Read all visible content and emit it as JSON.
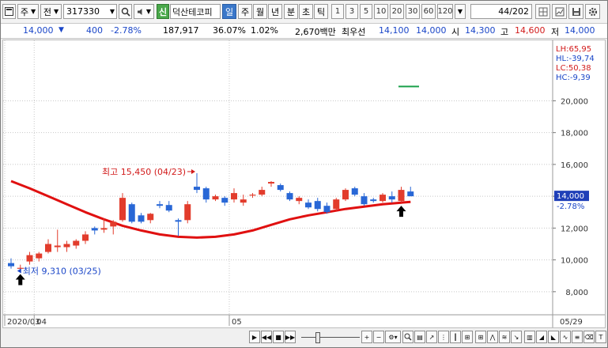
{
  "toolbar": {
    "market_label": "주",
    "period_label": "전",
    "stock_code": "317330",
    "sin_badge": "신",
    "stock_name": "덕산테코피",
    "tabs": [
      {
        "label": "일",
        "selected": true
      },
      {
        "label": "주",
        "selected": false
      },
      {
        "label": "월",
        "selected": false
      },
      {
        "label": "년",
        "selected": false
      },
      {
        "label": "분",
        "selected": false
      },
      {
        "label": "초",
        "selected": false
      },
      {
        "label": "틱",
        "selected": false
      }
    ],
    "intervals": [
      "1",
      "3",
      "5",
      "10",
      "20",
      "30",
      "60",
      "120"
    ],
    "count_value": "44",
    "count_total": "/202"
  },
  "quote": {
    "price": "14,000",
    "change": "400",
    "change_pct": "-2.78%",
    "volume": "187,917",
    "turnover_pct": "36.07%",
    "volume_pct": "1.02%",
    "amount": "2,670백만",
    "best_label": "최우선",
    "best_ask": "14,100",
    "best_bid": "14,000",
    "open_label": "시",
    "open": "14,300",
    "high_label": "고",
    "high": "14,600",
    "low_label": "저",
    "low": "14,000"
  },
  "chart_data": {
    "type": "candlestick",
    "y_ticks": [
      "20,000",
      "18,000",
      "16,000",
      "14,000",
      "12,000",
      "10,000",
      "8,000"
    ],
    "ylim": [
      6550,
      23800
    ],
    "x_labels": [
      {
        "label": "2020/03",
        "index": 0
      },
      {
        "label": "04",
        "index": 3
      },
      {
        "label": "05",
        "index": 24
      }
    ],
    "x_end_label": "05/29",
    "candles": [
      {
        "o": 9800,
        "h": 10100,
        "l": 9450,
        "c": 9600
      },
      {
        "o": 9450,
        "h": 9700,
        "l": 9310,
        "c": 9500
      },
      {
        "o": 9900,
        "h": 10500,
        "l": 9700,
        "c": 10300
      },
      {
        "o": 10100,
        "h": 10500,
        "l": 9900,
        "c": 10400
      },
      {
        "o": 10500,
        "h": 11300,
        "l": 10400,
        "c": 11000
      },
      {
        "o": 10800,
        "h": 11900,
        "l": 10500,
        "c": 10900
      },
      {
        "o": 10800,
        "h": 11200,
        "l": 10500,
        "c": 11000
      },
      {
        "o": 10900,
        "h": 11300,
        "l": 10700,
        "c": 11200
      },
      {
        "o": 11200,
        "h": 11800,
        "l": 11000,
        "c": 11600
      },
      {
        "o": 12000,
        "h": 12100,
        "l": 11600,
        "c": 11850
      },
      {
        "o": 11900,
        "h": 12600,
        "l": 11700,
        "c": 12000
      },
      {
        "o": 12100,
        "h": 12500,
        "l": 11600,
        "c": 12400
      },
      {
        "o": 12500,
        "h": 14200,
        "l": 12400,
        "c": 13900
      },
      {
        "o": 13500,
        "h": 13600,
        "l": 12300,
        "c": 12400
      },
      {
        "o": 12800,
        "h": 12950,
        "l": 12300,
        "c": 12400
      },
      {
        "o": 12500,
        "h": 12950,
        "l": 12300,
        "c": 12900
      },
      {
        "o": 13500,
        "h": 13700,
        "l": 13250,
        "c": 13400
      },
      {
        "o": 13450,
        "h": 13700,
        "l": 13000,
        "c": 13100
      },
      {
        "o": 12500,
        "h": 12600,
        "l": 11500,
        "c": 12400
      },
      {
        "o": 12500,
        "h": 13700,
        "l": 12300,
        "c": 13500
      },
      {
        "o": 14600,
        "h": 15450,
        "l": 14200,
        "c": 14400
      },
      {
        "o": 14500,
        "h": 14600,
        "l": 13600,
        "c": 13800
      },
      {
        "o": 13800,
        "h": 14100,
        "l": 13700,
        "c": 14000
      },
      {
        "o": 13900,
        "h": 14000,
        "l": 13400,
        "c": 13600
      },
      {
        "o": 13800,
        "h": 14500,
        "l": 13600,
        "c": 14200
      },
      {
        "o": 13600,
        "h": 14100,
        "l": 13400,
        "c": 13800
      },
      {
        "o": 14050,
        "h": 14200,
        "l": 13900,
        "c": 14100
      },
      {
        "o": 14100,
        "h": 14600,
        "l": 14000,
        "c": 14400
      },
      {
        "o": 14800,
        "h": 14950,
        "l": 14600,
        "c": 14900
      },
      {
        "o": 14700,
        "h": 14800,
        "l": 14300,
        "c": 14400
      },
      {
        "o": 14200,
        "h": 14300,
        "l": 13700,
        "c": 13800
      },
      {
        "o": 13700,
        "h": 14000,
        "l": 13500,
        "c": 13900
      },
      {
        "o": 13600,
        "h": 13800,
        "l": 13200,
        "c": 13300
      },
      {
        "o": 13700,
        "h": 13900,
        "l": 13050,
        "c": 13200
      },
      {
        "o": 13400,
        "h": 13600,
        "l": 12900,
        "c": 13000
      },
      {
        "o": 13200,
        "h": 13900,
        "l": 13100,
        "c": 13800
      },
      {
        "o": 13800,
        "h": 14500,
        "l": 13700,
        "c": 14400
      },
      {
        "o": 14500,
        "h": 14600,
        "l": 14000,
        "c": 14100
      },
      {
        "o": 14000,
        "h": 14200,
        "l": 13400,
        "c": 13500
      },
      {
        "o": 13800,
        "h": 13900,
        "l": 13600,
        "c": 13700
      },
      {
        "o": 13700,
        "h": 14200,
        "l": 13600,
        "c": 14100
      },
      {
        "o": 14000,
        "h": 14300,
        "l": 13600,
        "c": 13800
      },
      {
        "o": 13700,
        "h": 14600,
        "l": 13600,
        "c": 14400
      },
      {
        "o": 14300,
        "h": 14600,
        "l": 14000,
        "c": 14000
      }
    ],
    "moving_average": [
      {
        "i": 0,
        "v": 14950
      },
      {
        "i": 2,
        "v": 14500
      },
      {
        "i": 4,
        "v": 14000
      },
      {
        "i": 6,
        "v": 13500
      },
      {
        "i": 8,
        "v": 13000
      },
      {
        "i": 10,
        "v": 12550
      },
      {
        "i": 12,
        "v": 12150
      },
      {
        "i": 14,
        "v": 11850
      },
      {
        "i": 16,
        "v": 11600
      },
      {
        "i": 18,
        "v": 11450
      },
      {
        "i": 20,
        "v": 11400
      },
      {
        "i": 22,
        "v": 11450
      },
      {
        "i": 24,
        "v": 11600
      },
      {
        "i": 26,
        "v": 11850
      },
      {
        "i": 28,
        "v": 12200
      },
      {
        "i": 30,
        "v": 12550
      },
      {
        "i": 32,
        "v": 12800
      },
      {
        "i": 34,
        "v": 13000
      },
      {
        "i": 36,
        "v": 13200
      },
      {
        "i": 38,
        "v": 13350
      },
      {
        "i": 40,
        "v": 13500
      },
      {
        "i": 42,
        "v": 13600
      },
      {
        "i": 43,
        "v": 13650
      }
    ],
    "max_label": "최고 15,450 (04/23)",
    "max_index": 20,
    "max_value": 15450,
    "min_label": "최저 9,310 (03/25)",
    "min_index": 1,
    "min_value": 9310,
    "signal_arrow_indices": [
      1,
      42
    ],
    "current_price_label": "14,000",
    "current_pct_label": "-2.78%",
    "current_value": 14000,
    "indicators": [
      {
        "label": "LH:65,95",
        "color": "#d21b1b"
      },
      {
        "label": "HL:-39,74",
        "color": "#1a46c8"
      },
      {
        "label": "LC:50,38",
        "color": "#d21b1b"
      },
      {
        "label": "HC:-9,39",
        "color": "#1a46c8"
      }
    ],
    "green_marker_value": 20900,
    "up_color": "#e23c2c",
    "down_color": "#2867d6",
    "ma_color": "#e01010"
  }
}
